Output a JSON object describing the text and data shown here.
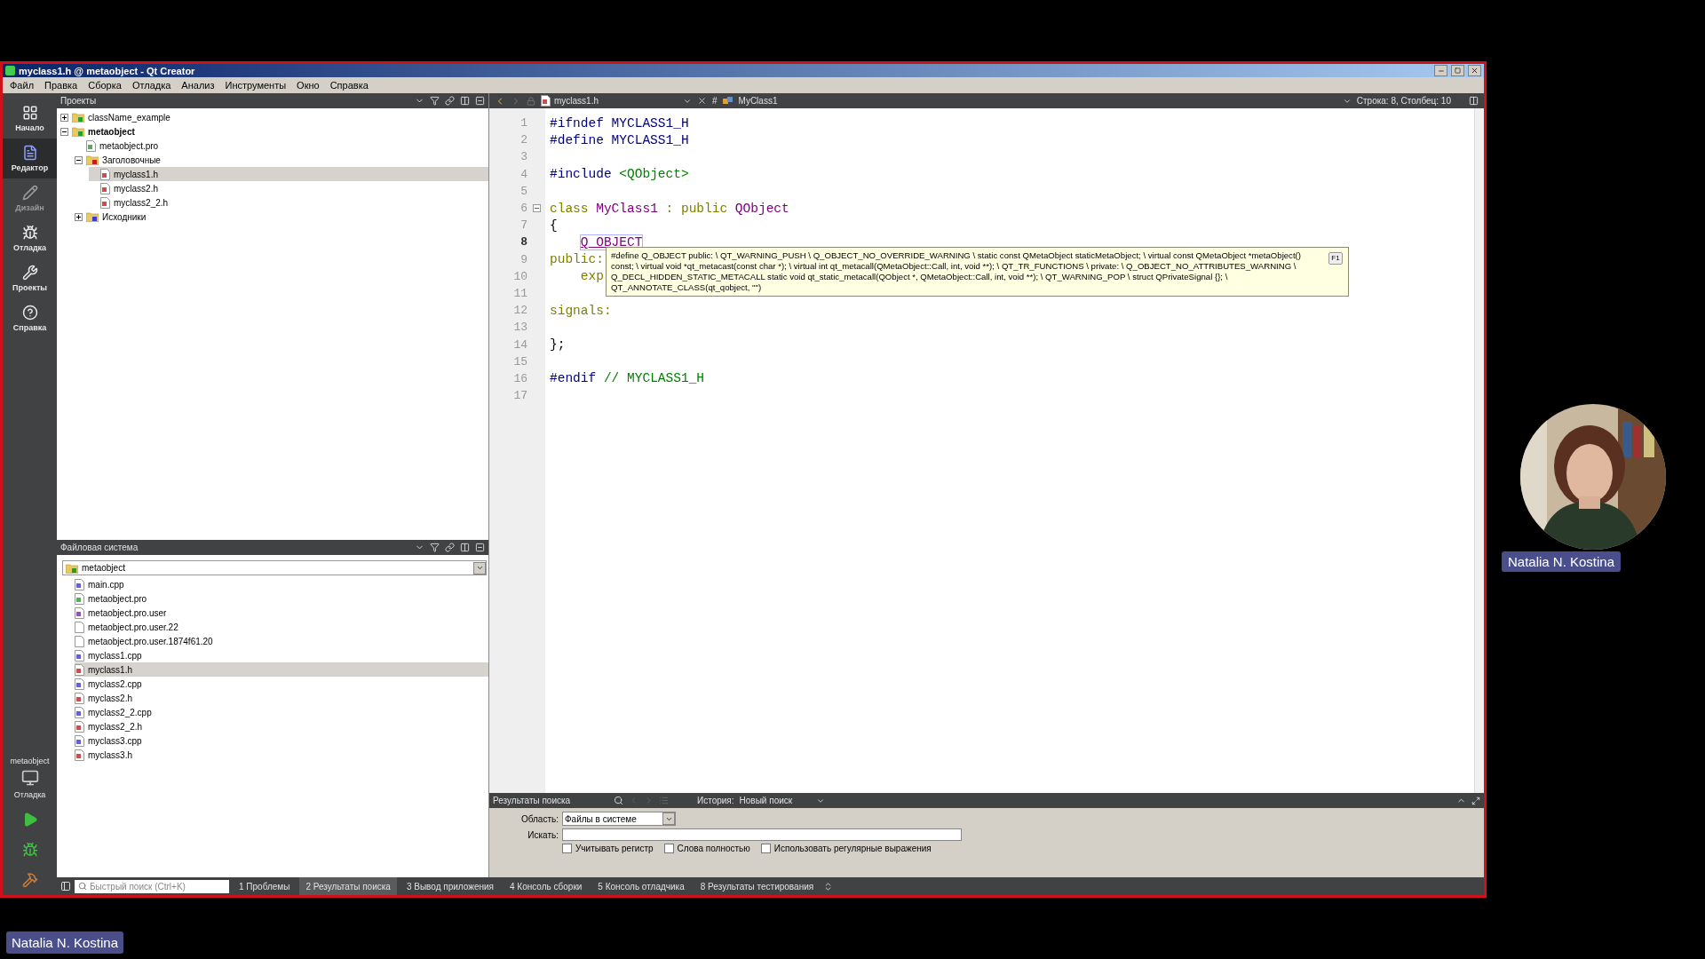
{
  "window": {
    "title": "myclass1.h @ metaobject - Qt Creator"
  },
  "menu": [
    "Файл",
    "Правка",
    "Сборка",
    "Отладка",
    "Анализ",
    "Инструменты",
    "Окно",
    "Справка"
  ],
  "modes": [
    {
      "label": "Начало",
      "kind": "welcome",
      "selected": false,
      "disabled": false
    },
    {
      "label": "Редактор",
      "kind": "edit",
      "selected": true,
      "disabled": false
    },
    {
      "label": "Дизайн",
      "kind": "design",
      "selected": false,
      "disabled": true
    },
    {
      "label": "Отладка",
      "kind": "debug",
      "selected": false,
      "disabled": false
    },
    {
      "label": "Проекты",
      "kind": "projects",
      "selected": false,
      "disabled": false
    },
    {
      "label": "Справка",
      "kind": "help",
      "selected": false,
      "disabled": false
    }
  ],
  "target": {
    "project": "metaobject",
    "mode": "Отладка"
  },
  "projects_pane": {
    "title": "Проекты",
    "tree": [
      {
        "name": "className_example",
        "kind": "project",
        "active": false,
        "expanded": false,
        "selected": false
      },
      {
        "name": "metaobject",
        "kind": "project",
        "active": true,
        "expanded": true,
        "selected": false,
        "children": [
          {
            "name": "metaobject.pro",
            "kind": "pro",
            "selected": false
          },
          {
            "name": "Заголовочные",
            "kind": "headers",
            "expanded": true,
            "selected": false,
            "children": [
              {
                "name": "myclass1.h",
                "kind": "header",
                "selected": true
              },
              {
                "name": "myclass2.h",
                "kind": "header",
                "selected": false
              },
              {
                "name": "myclass2_2.h",
                "kind": "header",
                "selected": false
              }
            ]
          },
          {
            "name": "Исходники",
            "kind": "sources",
            "expanded": false,
            "selected": false
          }
        ]
      }
    ]
  },
  "filesystem_pane": {
    "title": "Файловая система",
    "folder": "metaobject",
    "files": [
      {
        "name": "main.cpp",
        "kind": "cpp",
        "selected": false
      },
      {
        "name": "metaobject.pro",
        "kind": "pro",
        "selected": false
      },
      {
        "name": "metaobject.pro.user",
        "kind": "user",
        "selected": false
      },
      {
        "name": "metaobject.pro.user.22",
        "kind": "file",
        "selected": false
      },
      {
        "name": "metaobject.pro.user.1874f61.20",
        "kind": "file",
        "selected": false
      },
      {
        "name": "myclass1.cpp",
        "kind": "cpp",
        "selected": false
      },
      {
        "name": "myclass1.h",
        "kind": "header",
        "selected": true
      },
      {
        "name": "myclass2.cpp",
        "kind": "cpp",
        "selected": false
      },
      {
        "name": "myclass2.h",
        "kind": "header",
        "selected": false
      },
      {
        "name": "myclass2_2.cpp",
        "kind": "cpp",
        "selected": false
      },
      {
        "name": "myclass2_2.h",
        "kind": "header",
        "selected": false
      },
      {
        "name": "myclass3.cpp",
        "kind": "cpp",
        "selected": false
      },
      {
        "name": "myclass3.h",
        "kind": "header",
        "selected": false
      }
    ]
  },
  "editor": {
    "file": "myclass1.h",
    "symbol_marker": "#",
    "symbol": "MyClass1",
    "position": "Строка: 8, Столбец: 10",
    "lines": [
      {
        "number": "1",
        "fold": false,
        "current": false,
        "indent": false,
        "tokens": [
          {
            "text": "#ifndef MYCLASS1_H",
            "kind": "pre"
          }
        ]
      },
      {
        "number": "2",
        "fold": false,
        "current": false,
        "indent": false,
        "tokens": [
          {
            "text": "#define MYCLASS1_H",
            "kind": "pre"
          }
        ]
      },
      {
        "number": "3",
        "fold": false,
        "current": false
      },
      {
        "number": "4",
        "fold": false,
        "current": false,
        "indent": false,
        "tokens": [
          {
            "text": "#include ",
            "kind": "pre"
          },
          {
            "text": "<QObject>",
            "kind": "string"
          }
        ]
      },
      {
        "number": "5",
        "fold": false,
        "current": false
      },
      {
        "number": "6",
        "fold": true,
        "current": false,
        "indent": false,
        "tokens": [
          {
            "text": "class ",
            "kind": "keyword"
          },
          {
            "text": "MyClass1",
            "kind": "type"
          },
          {
            "text": " : public ",
            "kind": "keyword"
          },
          {
            "text": "QObject",
            "kind": "type"
          }
        ]
      },
      {
        "number": "7",
        "fold": false,
        "current": false,
        "indent": false,
        "tokens": [
          {
            "text": "{",
            "kind": "plain"
          }
        ]
      },
      {
        "number": "8",
        "fold": false,
        "current": true,
        "indent": true,
        "tokens": [
          {
            "text": "Q_OBJECT",
            "kind": "macro"
          }
        ]
      },
      {
        "number": "9",
        "fold": false,
        "current": false,
        "indent": false,
        "tokens": [
          {
            "text": "public:",
            "kind": "keyword"
          }
        ]
      },
      {
        "number": "10",
        "fold": false,
        "current": false,
        "indent": true,
        "tokens": [
          {
            "text": "exp",
            "kind": "keyword"
          }
        ]
      },
      {
        "number": "11",
        "fold": false,
        "current": false
      },
      {
        "number": "12",
        "fold": false,
        "current": false,
        "indent": false,
        "tokens": [
          {
            "text": "signals:",
            "kind": "keyword"
          }
        ]
      },
      {
        "number": "13",
        "fold": false,
        "current": false
      },
      {
        "number": "14",
        "fold": false,
        "current": false,
        "indent": false,
        "tokens": [
          {
            "text": "};",
            "kind": "plain"
          }
        ]
      },
      {
        "number": "15",
        "fold": false,
        "current": false
      },
      {
        "number": "16",
        "fold": false,
        "current": false,
        "indent": false,
        "tokens": [
          {
            "text": "#endif ",
            "kind": "pre"
          },
          {
            "text": "// MYCLASS1_H",
            "kind": "comment"
          }
        ]
      },
      {
        "number": "17",
        "fold": false,
        "current": false
      }
    ],
    "tooltip": {
      "text": "#define Q_OBJECT public: \\ QT_WARNING_PUSH \\ Q_OBJECT_NO_OVERRIDE_WARNING \\ static const QMetaObject staticMetaObject; \\ virtual const QMetaObject *metaObject() const; \\ virtual void *qt_metacast(const char *); \\ virtual int qt_metacall(QMetaObject::Call, int, void **); \\ QT_TR_FUNCTIONS \\ private: \\ Q_OBJECT_NO_ATTRIBUTES_WARNING \\ Q_DECL_HIDDEN_STATIC_METACALL static void qt_static_metacall(QObject *, QMetaObject::Call, int, void **); \\ QT_WARNING_POP \\ struct QPrivateSignal {}; \\ QT_ANNOTATE_CLASS(qt_qobject, \"\")",
      "key": "F1"
    }
  },
  "search_panel": {
    "title": "Результаты поиска",
    "history_label": "История:",
    "history": "Новый поиск",
    "scope_label": "Область:",
    "scope": "Файлы в системе",
    "search_label": "Искать:",
    "options": [
      {
        "label": "Учитывать регистр",
        "checked": false
      },
      {
        "label": "Слова полностью",
        "checked": false
      },
      {
        "label": "Использовать регулярные выражения",
        "checked": false
      }
    ]
  },
  "status_bar": {
    "search_placeholder": "Быстрый поиск (Ctrl+K)",
    "panes": [
      {
        "label": "1 Проблемы",
        "selected": false
      },
      {
        "label": "2 Результаты поиска",
        "selected": true
      },
      {
        "label": "3 Вывод приложения",
        "selected": false
      },
      {
        "label": "4 Консоль сборки",
        "selected": false
      },
      {
        "label": "5 Консоль отладчика",
        "selected": false
      },
      {
        "label": "8 Результаты тестирования",
        "selected": false
      }
    ]
  },
  "video_tile": {
    "name": "Natalia N. Kostina"
  },
  "presenter_label": "Natalia N. Kostina"
}
